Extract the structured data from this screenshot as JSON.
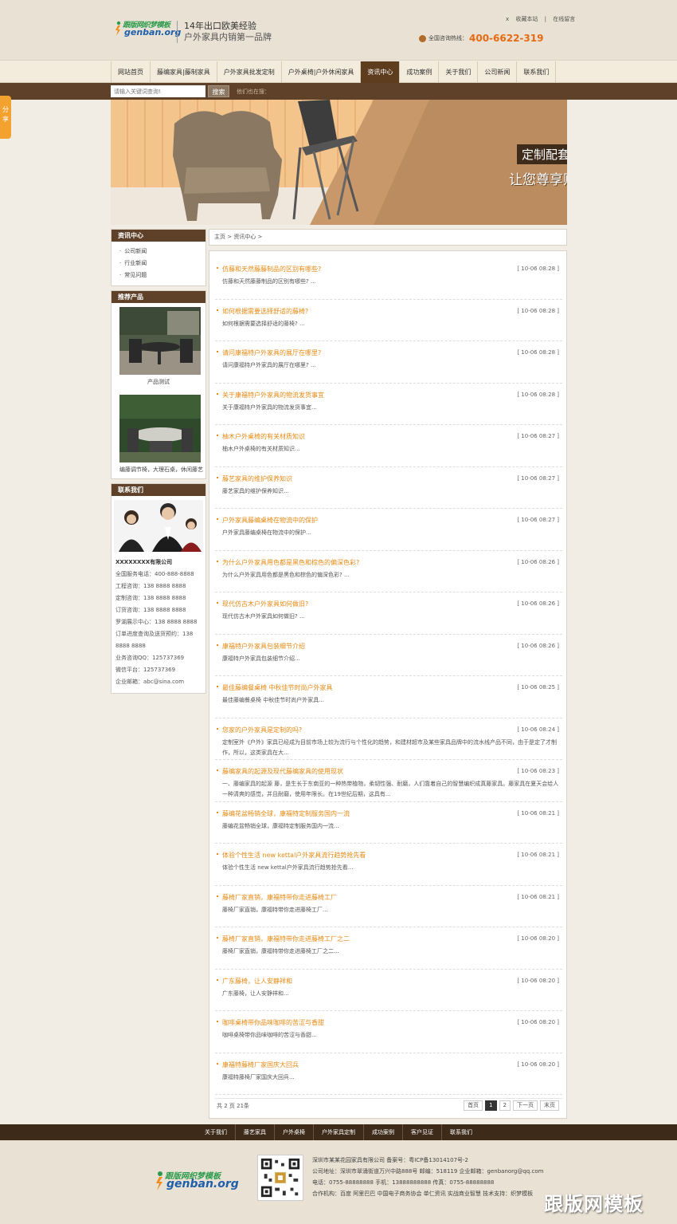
{
  "header": {
    "logo_line1": "跟版网织梦模板",
    "logo_line2": "genban.org",
    "slogan1": "14年出口欧美经验",
    "slogan2": "户外家具内销第一品牌",
    "toplinks": [
      "x",
      "收藏本站",
      "|",
      "在线留言"
    ],
    "hotline_label": "全国咨询热线：",
    "hotline_number": "400-6622-319"
  },
  "nav": {
    "items": [
      {
        "label": "网站首页"
      },
      {
        "label": "藤编家具|藤制家具"
      },
      {
        "label": "户外家具批发定制"
      },
      {
        "label": "户外桌椅|户外休闲家具"
      },
      {
        "label": "资讯中心"
      },
      {
        "label": "成功案例"
      },
      {
        "label": "关于我们"
      },
      {
        "label": "公司新闻"
      },
      {
        "label": "联系我们"
      }
    ],
    "active_index": 4
  },
  "search": {
    "placeholder": "请输入关键词查询!",
    "button": "搜索",
    "hotwords": "他们也在搜："
  },
  "share_label": "分享",
  "banner": {
    "line1": "定制配套,交货准时",
    "line2": "让您尊享贴心服务！"
  },
  "sidebar": {
    "news_title": "资讯中心",
    "news_items": [
      "公司新闻",
      "行业新闻",
      "常见问题"
    ],
    "products_title": "推荐产品",
    "products": [
      {
        "caption": "产品测试"
      },
      {
        "caption": "编藤调节椅，大理石桌，休闲藤艺"
      }
    ],
    "contact_title": "联系我们",
    "company": "XXXXXXXX有限公司",
    "contact_lines": [
      "全国服务电话：400-888-8888",
      "工程咨询：138 8888 8888",
      "定制咨询：138 8888 8888",
      "订货咨询：138 8888 8888",
      "罗湖展示中心：138 8888 8888",
      "订单进度查询及送货预约：138 8888 8888",
      "业务咨询QQ：125737369",
      "微信平台：125737369",
      "企业邮箱：abc@sina.com"
    ]
  },
  "breadcrumb": "主页 > 资讯中心 >",
  "articles": [
    {
      "title": "仿藤和天然藤藤制品的区别有哪些?",
      "date": "[ 10-06 08:28 ]",
      "desc": "仿藤和天然藤藤制品的区别有哪些? ..."
    },
    {
      "title": "如何根据需要选择舒适的藤椅?",
      "date": "[ 10-06 08:28 ]",
      "desc": "如何根据需要选择舒适的藤椅? ..."
    },
    {
      "title": "请问康福特户外家具的展厅在哪里?",
      "date": "[ 10-06 08:28 ]",
      "desc": "请问康福特户外家具的展厅在哪里? ..."
    },
    {
      "title": "关于康福特户外家具的物流发货事宜",
      "date": "[ 10-06 08:28 ]",
      "desc": "关于康福特户外家具的物流发货事宜..."
    },
    {
      "title": "柚木户外桌椅的有关材质知识",
      "date": "[ 10-06 08:27 ]",
      "desc": "柚木户外桌椅的有关材质知识..."
    },
    {
      "title": "藤艺家具的维护保养知识",
      "date": "[ 10-06 08:27 ]",
      "desc": "藤艺家具的维护保养知识..."
    },
    {
      "title": "户外家具藤编桌椅在物流中的保护",
      "date": "[ 10-06 08:27 ]",
      "desc": "户外家具藤编桌椅在物流中的保护..."
    },
    {
      "title": "为什么户外家具用色都是黑色和棕色的偏深色彩?",
      "date": "[ 10-06 08:26 ]",
      "desc": "为什么户外家具用色都是黑色和棕色的偏深色彩? ..."
    },
    {
      "title": "现代仿古木户外家具如何做旧?",
      "date": "[ 10-06 08:26 ]",
      "desc": "现代仿古木户外家具如何做旧? ..."
    },
    {
      "title": "康福特户外家具包装细节介绍",
      "date": "[ 10-06 08:26 ]",
      "desc": "康福特户外家具包装细节介绍..."
    },
    {
      "title": "最佳藤编餐桌椅 中秋佳节时尚户外家具",
      "date": "[ 10-06 08:25 ]",
      "desc": "最佳藤编餐桌椅 中秋佳节时尚户外家具..."
    },
    {
      "title": "您家的户外家具是定制的吗?",
      "date": "[ 10-06 08:24 ]",
      "desc": "定制室外《户外》家具已经成为目前市场上较为流行与个性化的趋势，和建材超市及某些家具品牌中的流水线产品不同，由于是定了才制作，所以，这类家具在大..."
    },
    {
      "title": "藤编家具的起源及现代藤编家具的使用现状",
      "date": "[ 10-06 08:23 ]",
      "desc": "一、藤编家具的起源 藤，是生长于东南亚的一种热带植物，柔韧性强、耐磨，人们靠着自己的智慧编织成真藤家具。藤家具在夏天会给人一种清爽的感觉，并且耐磨，使用年限长。在19世纪后期，这具有..."
    },
    {
      "title": "藤编花盆畅销全球，康福特定制服务国内一流",
      "date": "[ 10-06 08:21 ]",
      "desc": "藤编花盆畅销全球，康福特定制服务国内一流..."
    },
    {
      "title": "体验个性生活 new kettal户外家具流行趋势抢先看",
      "date": "[ 10-06 08:21 ]",
      "desc": "体验个性生活 new kettal户外家具流行趋势抢先看..."
    },
    {
      "title": "藤椅厂家直销，康福特带你走进藤椅工厂",
      "date": "[ 10-06 08:21 ]",
      "desc": "藤椅厂家直销，康福特带你走进藤椅工厂..."
    },
    {
      "title": "藤椅厂家直销，康福特带你走进藤椅工厂之二",
      "date": "[ 10-06 08:20 ]",
      "desc": "藤椅厂家直销，康福特带你走进藤椅工厂之二..."
    },
    {
      "title": "广东藤椅，让人安静祥和",
      "date": "[ 10-06 08:20 ]",
      "desc": "广东藤椅，让人安静祥和..."
    },
    {
      "title": "咖啡桌椅带你品味咖啡的苦涩与香甜",
      "date": "[ 10-06 08:20 ]",
      "desc": "咖啡桌椅带你品味咖啡的苦涩与香甜..."
    },
    {
      "title": "康福特藤椅厂家国庆大回兵",
      "date": "[ 10-06 08:20 ]",
      "desc": "康福特藤椅厂家国庆大回兵..."
    }
  ],
  "pager": {
    "info": "共 2 页 21条",
    "first": "首页",
    "pages": [
      "1",
      "2"
    ],
    "next": "下一页",
    "last": "末页"
  },
  "footer": {
    "links": [
      "关于我们",
      "藤艺家具",
      "户外桌椅",
      "户外家具定制",
      "成功案例",
      "客户见证",
      "联系我们"
    ],
    "info_lines": [
      "深圳市某某花园家具有限公司 备案号：粤ICP备13014107号-2",
      "公司地址：深圳市翠涌街道万兴中路888号    邮编：518119    企业邮箱：genbanorg@qq.com",
      "电话：0755-88888888    手机：13888888888    传真：0755-88888888",
      "合作机构：百度 阿里巴巴 中国电子商务协会 单仁资讯 实战商业智慧  技术支持：织梦模板"
    ],
    "logo_line1": "跟版网织梦模板",
    "logo_line2": "genban.org",
    "watermark": "跟版网模板"
  },
  "colors": {
    "accent": "#e58a14",
    "dark_brown": "#5e4128",
    "footer_bar": "#3d2a19",
    "header_bg": "#e9e1d3"
  }
}
